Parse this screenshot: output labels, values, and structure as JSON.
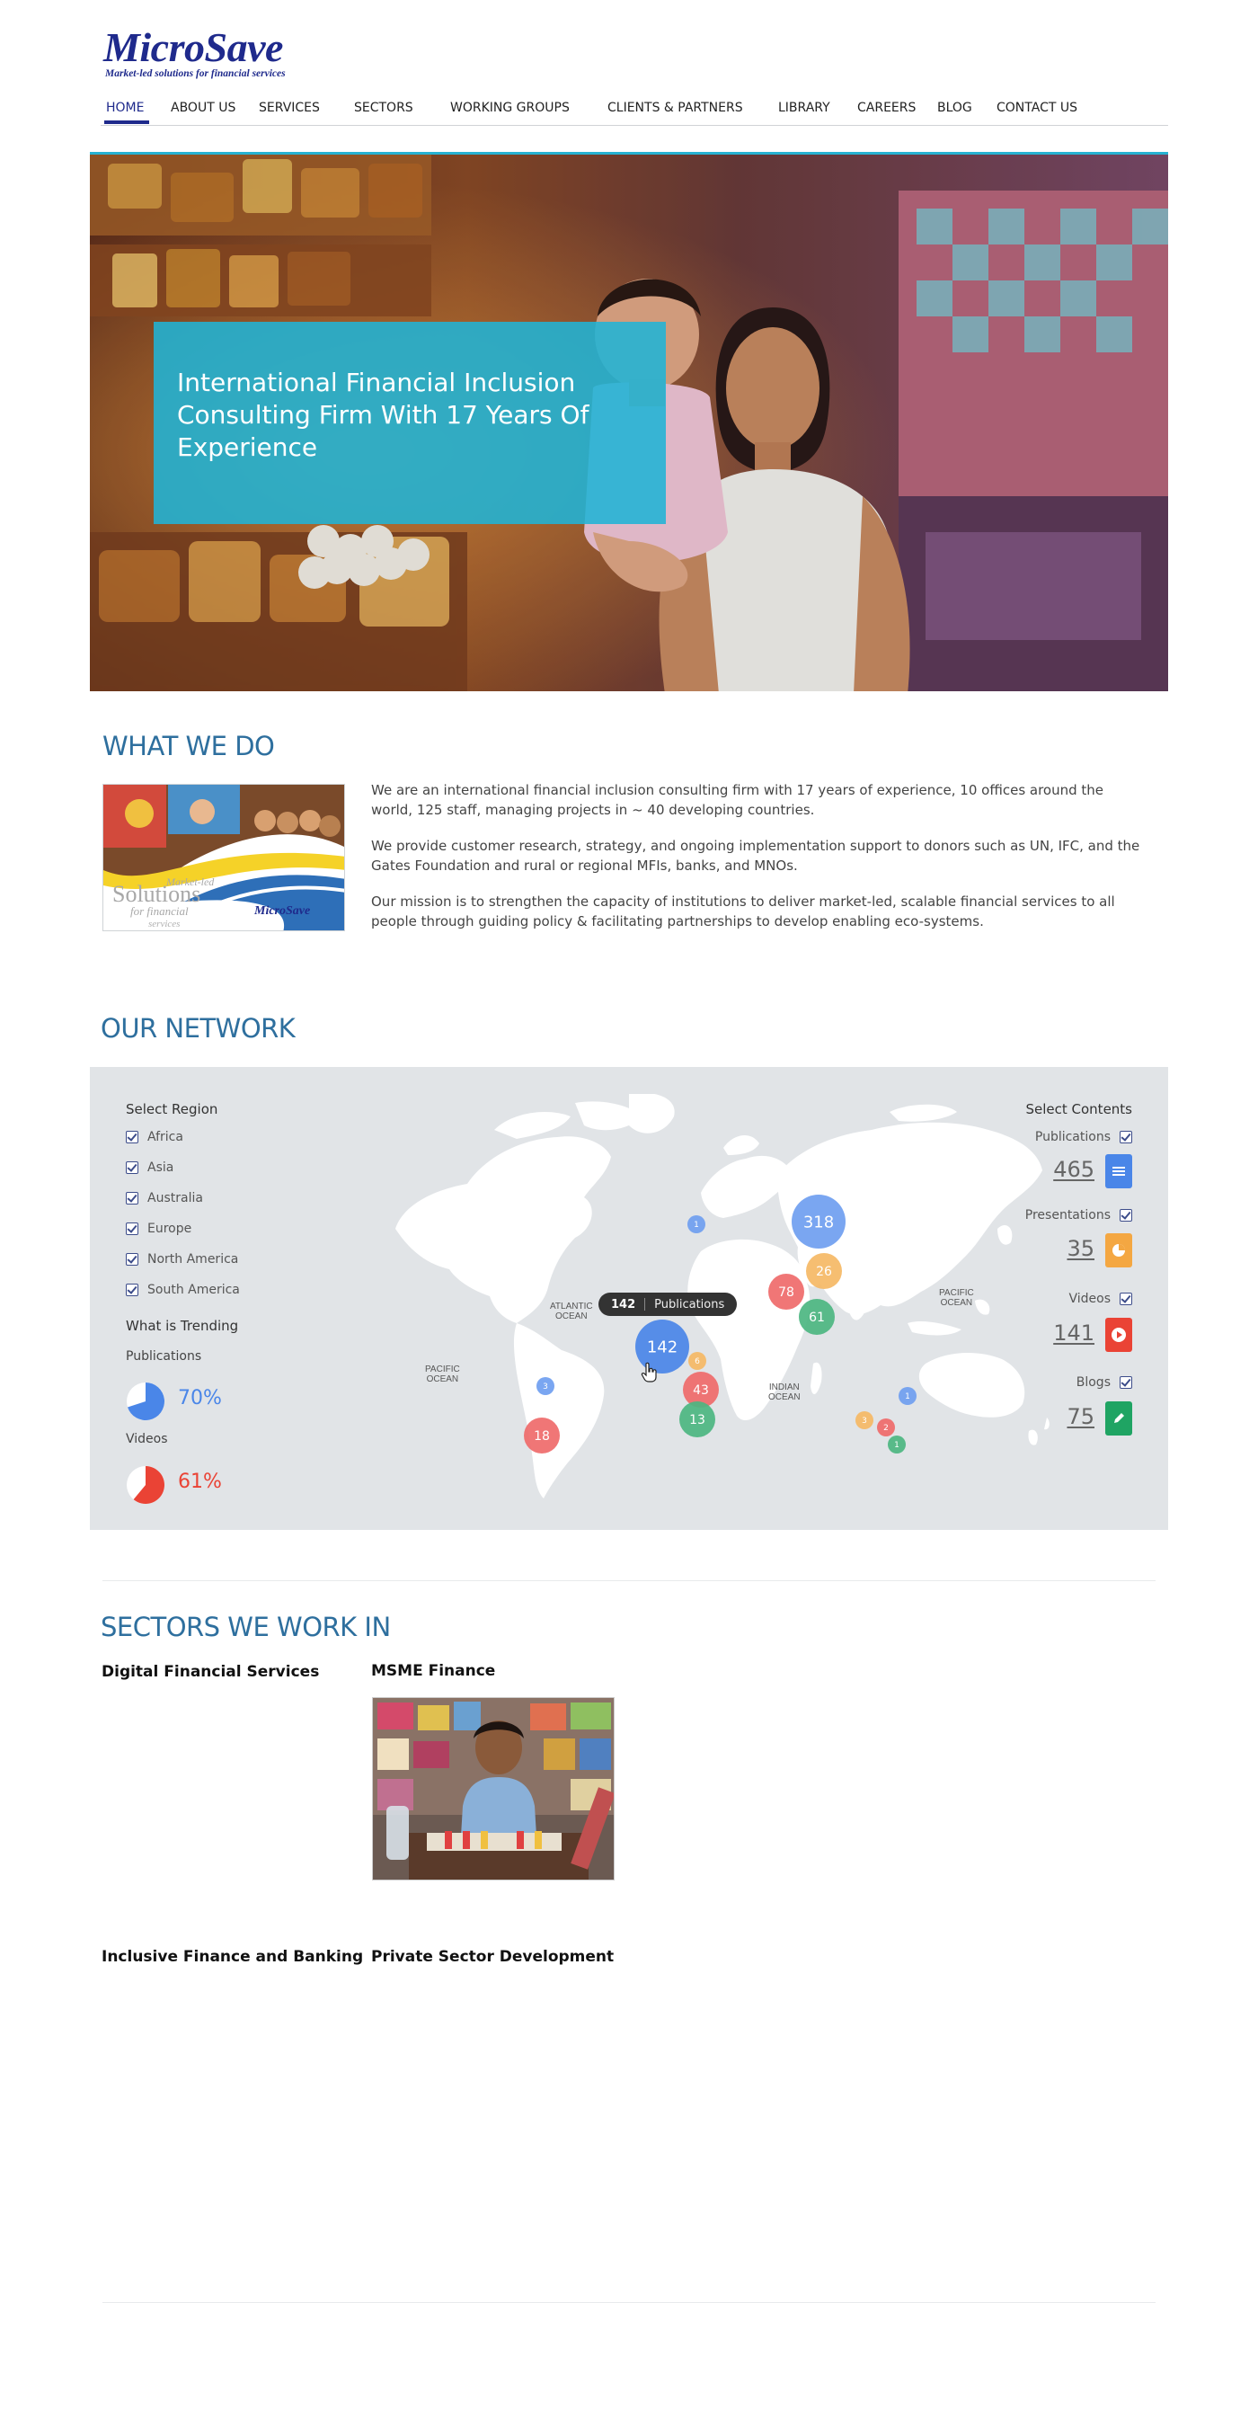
{
  "header": {
    "logo_text": "MicroSave",
    "logo_tagline": "Market-led solutions for financial services",
    "nav": [
      {
        "label": "HOME",
        "active": true
      },
      {
        "label": "ABOUT US"
      },
      {
        "label": "SERVICES"
      },
      {
        "label": "SECTORS"
      },
      {
        "label": "WORKING GROUPS"
      },
      {
        "label": "CLIENTS & PARTNERS"
      },
      {
        "label": "LIBRARY"
      },
      {
        "label": "CAREERS"
      },
      {
        "label": "BLOG"
      },
      {
        "label": "CONTACT US"
      }
    ]
  },
  "hero": {
    "title": "International Financial Inclusion Consulting Firm With 17 Years Of Experience",
    "accent_color": "#22b4d6"
  },
  "what_we_do": {
    "title": "WHAT WE DO",
    "thumb_text": {
      "line1": "Market-led",
      "line2": "Solutions",
      "line3": "for financial",
      "line4": "services",
      "brand": "MicroSave"
    },
    "paragraphs": [
      "We are an international financial inclusion consulting firm with 17 years of experience, 10 offices around the world, 125 staff, managing projects in ~ 40 developing countries.",
      "We provide customer research, strategy, and ongoing implementation support to donors such as UN, IFC, and the Gates Foundation and rural or regional MFIs, banks, and MNOs.",
      "Our mission is to strengthen the capacity of institutions to deliver market-led, scalable financial services to all people through guiding policy & facilitating partnerships to develop enabling eco-systems."
    ]
  },
  "network": {
    "title": "OUR NETWORK",
    "select_region": "Select Region",
    "regions": [
      "Africa",
      "Asia",
      "Australia",
      "Europe",
      "North America",
      "South America"
    ],
    "trending_title": "What is Trending",
    "trending": [
      {
        "label": "Publications",
        "value": "70%",
        "fraction": 0.7,
        "color": "#4a86e8"
      },
      {
        "label": "Videos",
        "value": "61%",
        "fraction": 0.61,
        "color": "#ea4335"
      }
    ],
    "select_contents": "Select Contents",
    "contents": [
      {
        "label": "Publications",
        "count": "465",
        "color": "#4a86e8",
        "icon": "document-icon"
      },
      {
        "label": "Presentations",
        "count": "35",
        "color": "#f4a742",
        "icon": "pie-chart-icon"
      },
      {
        "label": "Videos",
        "count": "141",
        "color": "#ea4335",
        "icon": "play-icon"
      },
      {
        "label": "Blogs",
        "count": "75",
        "color": "#1fa463",
        "icon": "pencil-icon"
      }
    ],
    "oceans": {
      "atlantic": [
        "ATLANTIC",
        "OCEAN"
      ],
      "pacific_left": [
        "PACIFIC",
        "OCEAN"
      ],
      "pacific_right": [
        "PACIFIC",
        "OCEAN"
      ],
      "indian": [
        "INDIAN",
        "OCEAN"
      ]
    },
    "bubbles": [
      {
        "value": "318",
        "color": "#6f9ef0"
      },
      {
        "value": "26",
        "color": "#f5b865"
      },
      {
        "value": "78",
        "color": "#ef6a6a"
      },
      {
        "value": "61",
        "color": "#4cb681"
      },
      {
        "value": "1",
        "color": "#6f9ef0"
      },
      {
        "value": "142",
        "color": "#4a86e8"
      },
      {
        "value": "6",
        "color": "#f5b865"
      },
      {
        "value": "43",
        "color": "#ef6a6a"
      },
      {
        "value": "13",
        "color": "#4cb681"
      },
      {
        "value": "3",
        "color": "#6f9ef0"
      },
      {
        "value": "18",
        "color": "#ef6a6a"
      },
      {
        "value": "1",
        "color": "#6f9ef0"
      },
      {
        "value": "3",
        "color": "#f5b865"
      },
      {
        "value": "2",
        "color": "#ef6a6a"
      },
      {
        "value": "1",
        "color": "#4cb681"
      }
    ],
    "tooltip": {
      "value": "142",
      "label": "Publications"
    }
  },
  "sectors": {
    "title": "SECTORS WE WORK IN",
    "items": [
      "Digital Financial Services",
      "MSME Finance",
      "Inclusive Finance and Banking",
      "Private Sector Development"
    ]
  }
}
